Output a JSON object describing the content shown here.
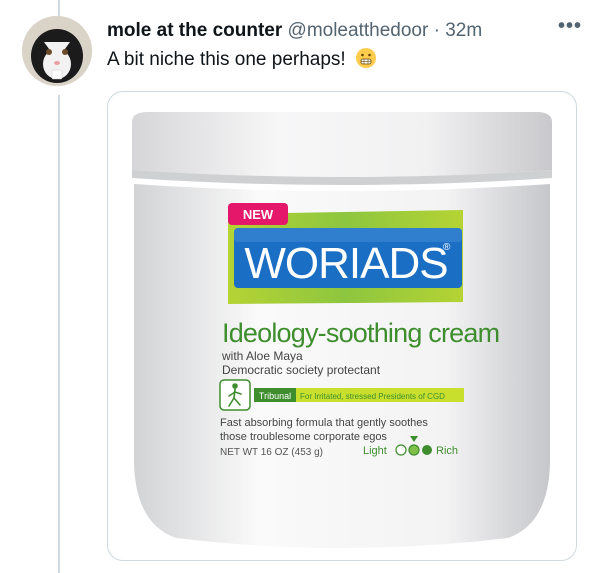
{
  "tweet": {
    "display_name": "mole at the counter",
    "handle": "@moleatthedoor",
    "separator": "·",
    "time": "32m",
    "more_glyph": "•••",
    "text": "A bit niche this one perhaps!",
    "emoji": "grimacing-face-emoji"
  },
  "product": {
    "badge": "NEW",
    "brand": "WORIADS",
    "trademark": "®",
    "name": "Ideology-soothing cream",
    "sub1": "with Aloe Maya",
    "sub2": "Democratic society protectant",
    "tribunal": "Tribunal",
    "tribunal_desc": "For Irritated, stressed Presidents of CGD",
    "desc1": "Fast absorbing formula that gently soothes",
    "desc2": "those troublesome corporate egos",
    "net_wt": "NET WT  16 OZ  (453 g)",
    "light": "Light",
    "rich": "Rich"
  },
  "colors": {
    "brand_blue": "#1a6fc4",
    "lime": "#8dc63f",
    "badge_pink": "#e5176b",
    "text_green": "#3e8e2e",
    "meta_gray": "#536471"
  }
}
